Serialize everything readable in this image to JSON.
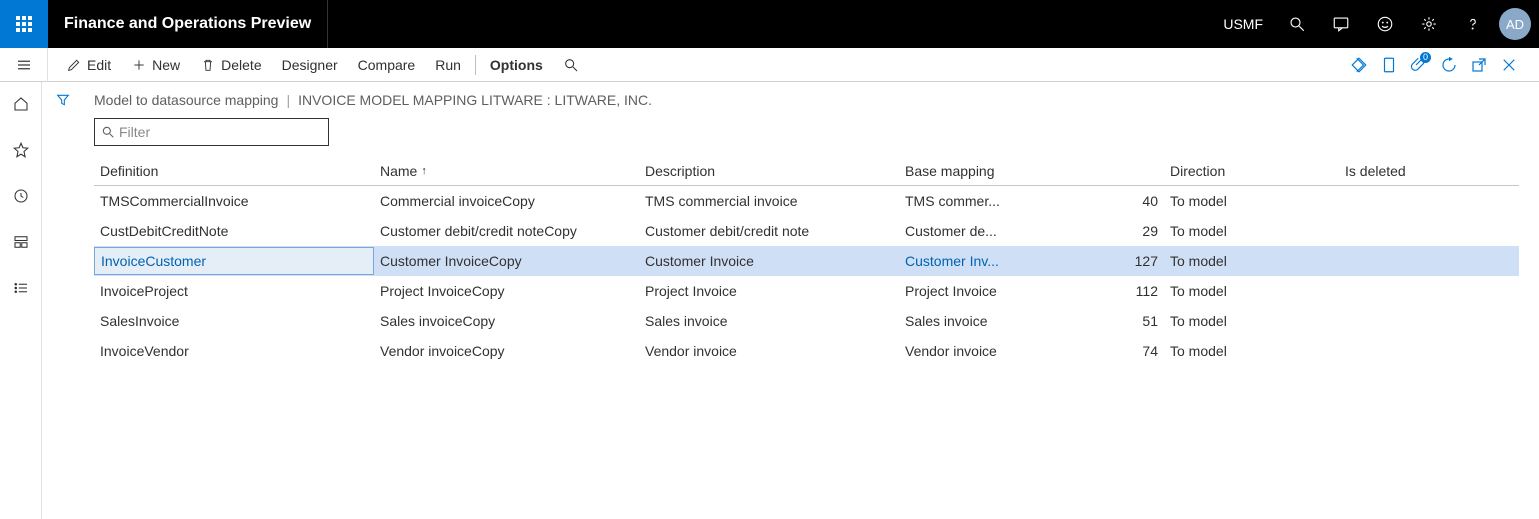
{
  "header": {
    "app_title": "Finance and Operations Preview",
    "company_code": "USMF",
    "avatar_initials": "AD"
  },
  "toolbar": {
    "edit": "Edit",
    "new": "New",
    "delete": "Delete",
    "designer": "Designer",
    "compare": "Compare",
    "run": "Run",
    "options": "Options",
    "attach_badge": "0"
  },
  "breadcrumb": {
    "part1": "Model to datasource mapping",
    "part2": "INVOICE MODEL MAPPING LITWARE : LITWARE, INC."
  },
  "filter": {
    "placeholder": "Filter"
  },
  "grid": {
    "headers": {
      "definition": "Definition",
      "name": "Name",
      "description": "Description",
      "base_mapping": "Base mapping",
      "count": "",
      "direction": "Direction",
      "is_deleted": "Is deleted"
    },
    "rows": [
      {
        "definition": "TMSCommercialInvoice",
        "name": "Commercial invoiceCopy",
        "description": "TMS commercial invoice",
        "base_mapping": "TMS commer...",
        "count": "40",
        "direction": "To model",
        "is_deleted": "",
        "selected": false
      },
      {
        "definition": "CustDebitCreditNote",
        "name": "Customer debit/credit noteCopy",
        "description": "Customer debit/credit note",
        "base_mapping": "Customer de...",
        "count": "29",
        "direction": "To model",
        "is_deleted": "",
        "selected": false
      },
      {
        "definition": "InvoiceCustomer",
        "name": "Customer InvoiceCopy",
        "description": "Customer Invoice",
        "base_mapping": "Customer Inv...",
        "count": "127",
        "direction": "To model",
        "is_deleted": "",
        "selected": true
      },
      {
        "definition": "InvoiceProject",
        "name": "Project InvoiceCopy",
        "description": "Project Invoice",
        "base_mapping": "Project Invoice",
        "count": "112",
        "direction": "To model",
        "is_deleted": "",
        "selected": false
      },
      {
        "definition": "SalesInvoice",
        "name": "Sales invoiceCopy",
        "description": "Sales invoice",
        "base_mapping": "Sales invoice",
        "count": "51",
        "direction": "To model",
        "is_deleted": "",
        "selected": false
      },
      {
        "definition": "InvoiceVendor",
        "name": "Vendor invoiceCopy",
        "description": "Vendor invoice",
        "base_mapping": "Vendor invoice",
        "count": "74",
        "direction": "To model",
        "is_deleted": "",
        "selected": false
      }
    ]
  }
}
